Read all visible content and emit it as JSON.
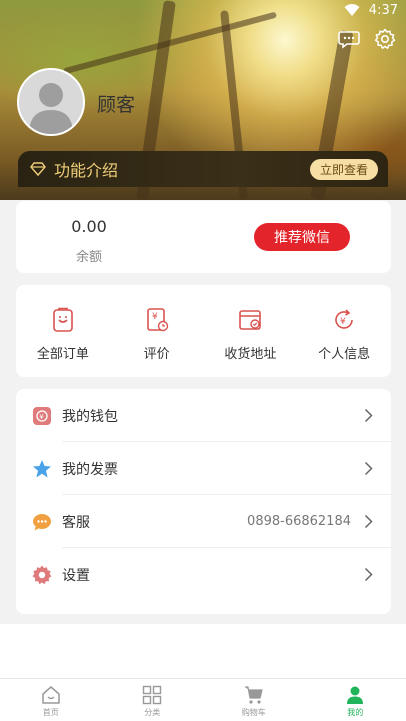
{
  "status_bar": {
    "time": "4:37"
  },
  "profile": {
    "username": "顾客"
  },
  "feature_banner": {
    "label": "功能介绍",
    "button": "立即查看"
  },
  "balance": {
    "value": "0.00",
    "label": "余额",
    "recommend_button": "推荐微信"
  },
  "orders": [
    {
      "label": "全部订单",
      "icon": "order-clipboard-icon"
    },
    {
      "label": "评价",
      "icon": "review-icon"
    },
    {
      "label": "收货地址",
      "icon": "address-icon"
    },
    {
      "label": "个人信息",
      "icon": "profile-refresh-icon"
    }
  ],
  "menu": [
    {
      "label": "我的钱包",
      "value": "",
      "icon": "wallet-icon"
    },
    {
      "label": "我的发票",
      "value": "",
      "icon": "star-icon"
    },
    {
      "label": "客服",
      "value": "0898-66862184",
      "icon": "chat-bubble-icon"
    },
    {
      "label": "设置",
      "value": "",
      "icon": "settings-gear-icon"
    }
  ],
  "tabbar": [
    {
      "label": "首页",
      "icon": "home-icon",
      "active": false
    },
    {
      "label": "分类",
      "icon": "grid-icon",
      "active": false
    },
    {
      "label": "购物车",
      "icon": "cart-icon",
      "active": false
    },
    {
      "label": "我的",
      "icon": "user-icon",
      "active": true
    }
  ],
  "colors": {
    "accent_red": "#e4242b",
    "banner_gold": "#f2d07a",
    "active_tab": "#1fb45a",
    "icon_red": "#d9534f"
  }
}
